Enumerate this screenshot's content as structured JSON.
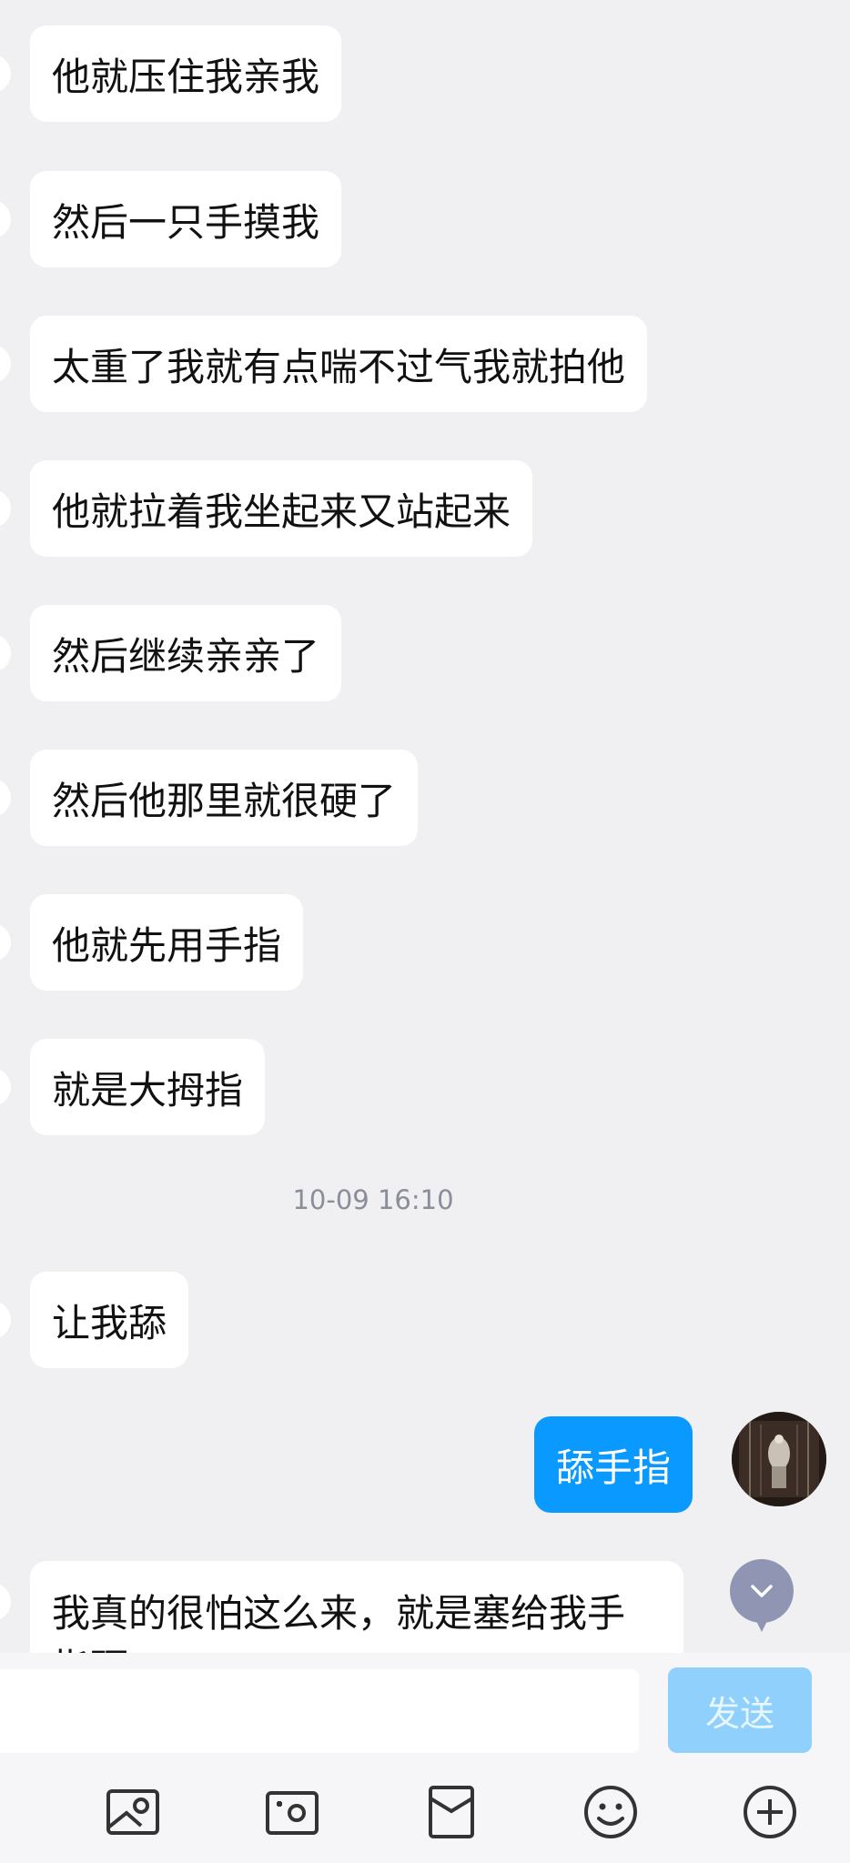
{
  "messages": [
    {
      "direction": "in",
      "text": "他就压住我亲我"
    },
    {
      "direction": "in",
      "text": "然后一只手摸我"
    },
    {
      "direction": "in",
      "text": "太重了我就有点喘不过气我就拍他"
    },
    {
      "direction": "in",
      "text": "他就拉着我坐起来又站起来"
    },
    {
      "direction": "in",
      "text": "然后继续亲亲了"
    },
    {
      "direction": "in",
      "text": "然后他那里就很硬了"
    },
    {
      "direction": "in",
      "text": "他就先用手指"
    },
    {
      "direction": "in",
      "text": "就是大拇指"
    },
    {
      "direction": "in",
      "text": "让我舔"
    },
    {
      "direction": "out",
      "text": "舔手指"
    },
    {
      "direction": "in",
      "text": "我真的很怕这么来，就是塞给我手指硬"
    }
  ],
  "timestamp": "10-09 16:10",
  "input": {
    "value": "",
    "placeholder": ""
  },
  "send_label": "发送",
  "toolbar_icons": [
    "image-icon",
    "camera-icon",
    "red-packet-icon",
    "emoji-icon",
    "plus-icon"
  ],
  "colors": {
    "background": "#f0f0f2",
    "outgoing_bubble": "#0a99ff",
    "send_button": "#8fd0fd",
    "icon": "#333333"
  }
}
